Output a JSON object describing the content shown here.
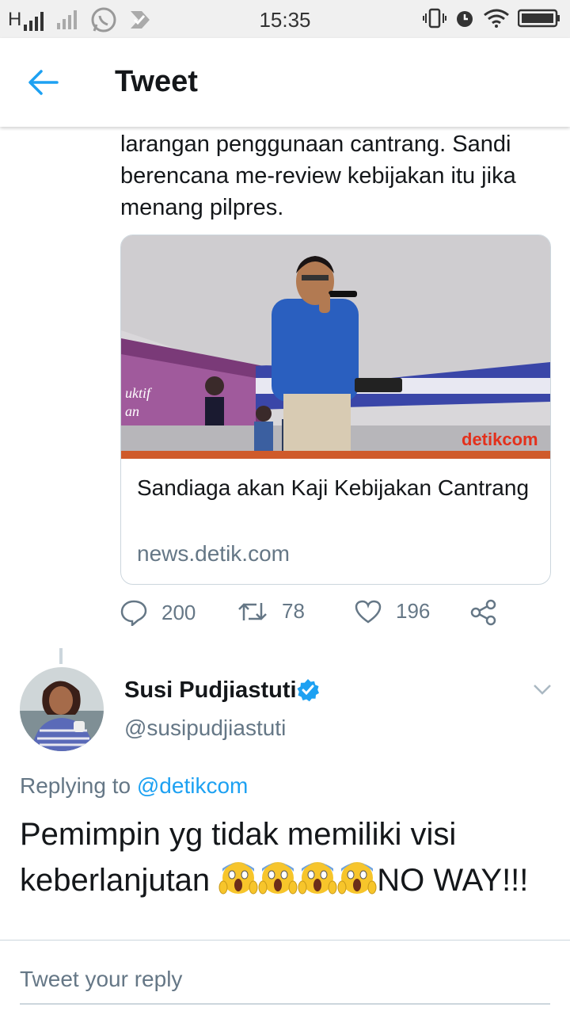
{
  "status_bar": {
    "time": "15:35",
    "carrier": "H"
  },
  "header": {
    "title": "Tweet"
  },
  "tweet": {
    "text": "larangan penggunaan cantrang. Sandi berencana me-review kebijakan itu jika menang pilpres.",
    "card": {
      "title": "Sandiaga akan Kaji Kebijakan Cantrang",
      "domain": "news.detik.com",
      "image_watermark": "detikcom"
    },
    "actions": {
      "replies": "200",
      "retweets": "78",
      "likes": "196"
    }
  },
  "reply": {
    "name": "Susi Pudjiastuti",
    "handle": "@susipudjiastuti",
    "replying_prefix": "Replying to",
    "replying_to": "@detikcom",
    "text_part1": "Pemimpin yg tidak memiliki visi keberlanjutan ",
    "emoji": "😱",
    "text_part2": "NO WAY!!!"
  },
  "composer": {
    "placeholder": "Tweet your reply"
  },
  "colors": {
    "accent": "#1da1f2",
    "secondary_text": "#657786",
    "border": "#ccd6dd"
  }
}
